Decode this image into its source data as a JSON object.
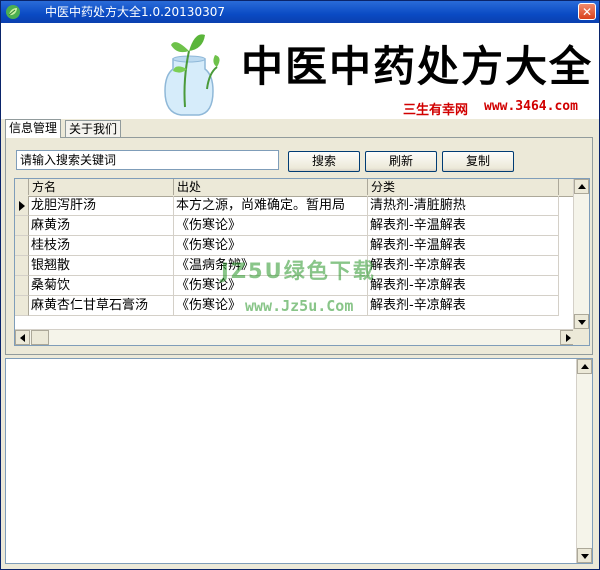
{
  "window": {
    "title": "中医中药处方大全1.0.20130307",
    "close_symbol": "✕"
  },
  "banner": {
    "title": "中医中药处方大全",
    "site_name": "三生有幸网",
    "site_url": "www.3464.com"
  },
  "tabs": [
    {
      "label": "信息管理",
      "active": true
    },
    {
      "label": "关于我们",
      "active": false
    }
  ],
  "search": {
    "value": "请输入搜索关键词"
  },
  "buttons": {
    "search": "搜索",
    "refresh": "刷新",
    "copy": "复制"
  },
  "table": {
    "columns": [
      "方名",
      "出处",
      "分类"
    ],
    "rows": [
      {
        "name": "龙胆泻肝汤",
        "source": "本方之源，尚难确定。暂用局",
        "category": "清热剂-清脏腑热",
        "selected": true
      },
      {
        "name": "麻黄汤",
        "source": "《伤寒论》",
        "category": "解表剂-辛温解表",
        "selected": false
      },
      {
        "name": "桂枝汤",
        "source": "《伤寒论》",
        "category": "解表剂-辛温解表",
        "selected": false
      },
      {
        "name": "银翘散",
        "source": "《温病条辨》",
        "category": "解表剂-辛凉解表",
        "selected": false
      },
      {
        "name": "桑菊饮",
        "source": "《伤寒论》",
        "category": "解表剂-辛凉解表",
        "selected": false
      },
      {
        "name": "麻黄杏仁甘草石膏汤",
        "source": "《伤寒论》",
        "category": "解表剂-辛凉解表",
        "selected": false
      }
    ]
  },
  "watermark": {
    "text": "JZ5U绿色下载",
    "url": "www.Jz5u.Com"
  },
  "colors": {
    "titlebar": "#0a4bc4",
    "banner_accent": "#d10000",
    "watermark": "#2a962a"
  },
  "icons": {
    "app": "leaf-icon",
    "close": "close-icon",
    "row_indicator": "triangle-right-icon"
  }
}
